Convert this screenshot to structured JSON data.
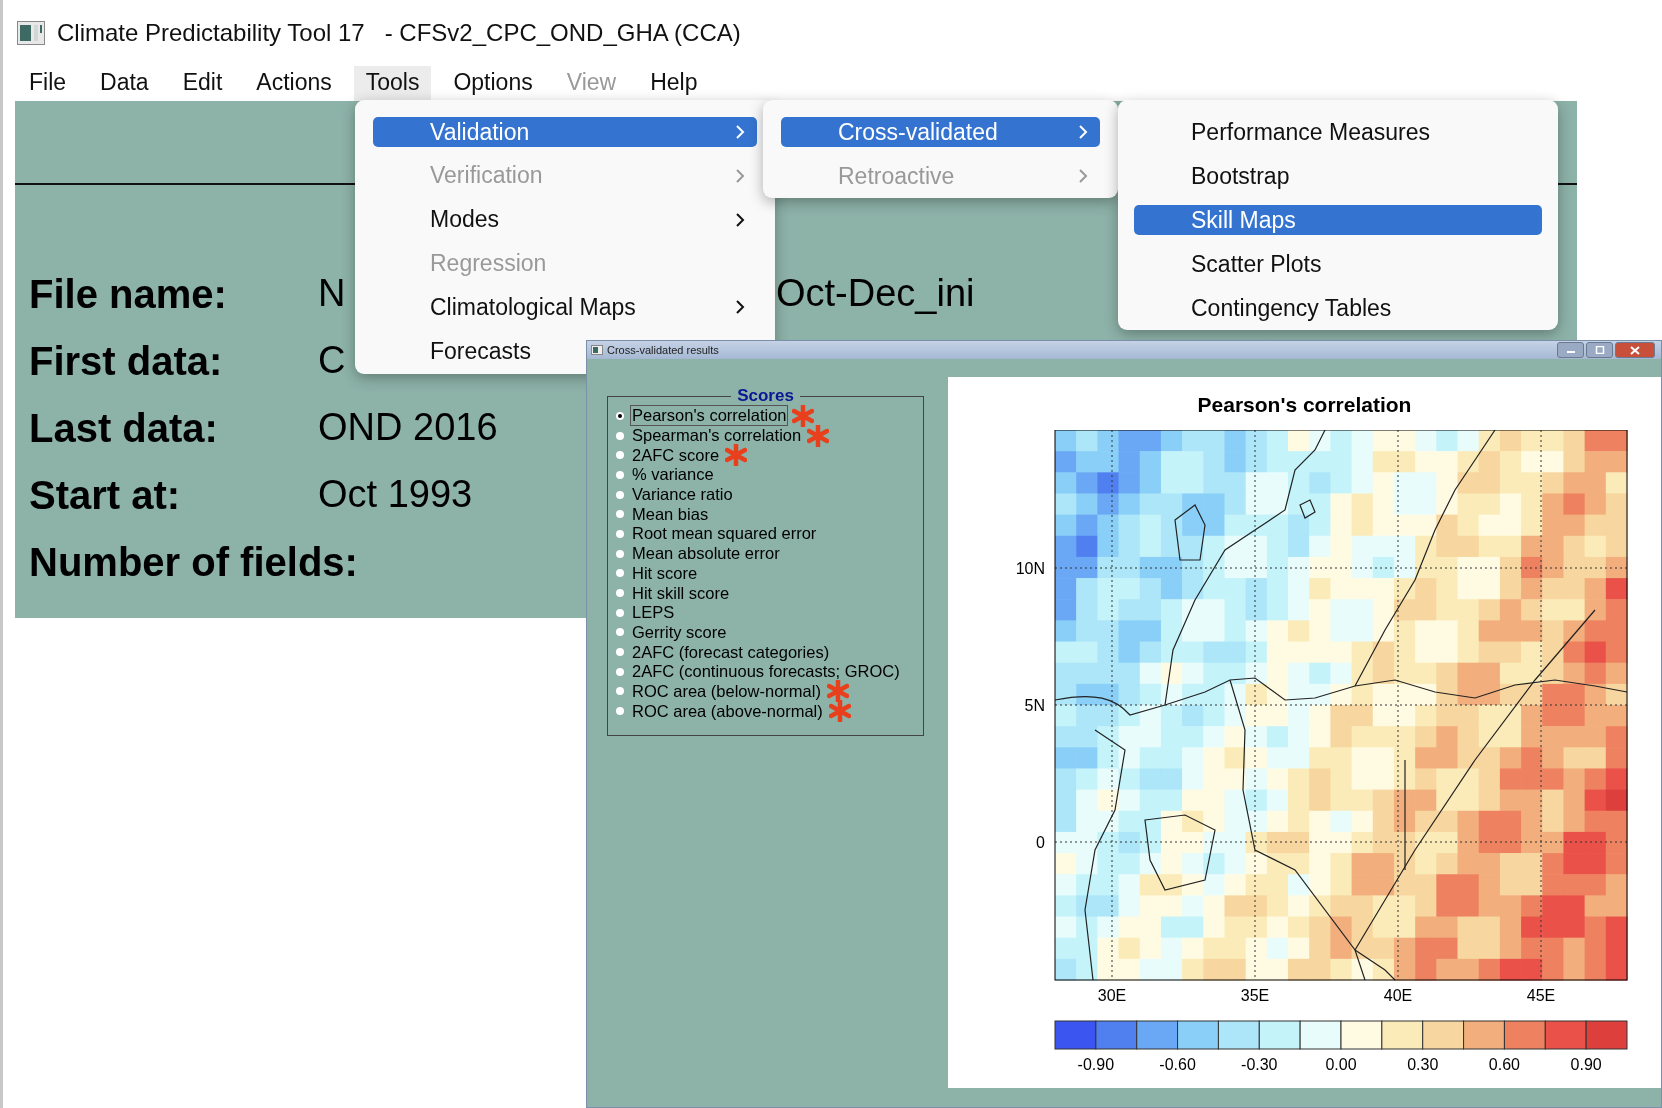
{
  "window": {
    "title": "Climate Predictability Tool 17   - CFSv2_CPC_OND_GHA (CCA)"
  },
  "menu_bar": [
    {
      "label": "File",
      "selected": false,
      "disabled": false
    },
    {
      "label": "Data",
      "selected": false,
      "disabled": false
    },
    {
      "label": "Edit",
      "selected": false,
      "disabled": false
    },
    {
      "label": "Actions",
      "selected": false,
      "disabled": false
    },
    {
      "label": "Tools",
      "selected": true,
      "disabled": false
    },
    {
      "label": "Options",
      "selected": false,
      "disabled": false
    },
    {
      "label": "View",
      "selected": false,
      "disabled": true
    },
    {
      "label": "Help",
      "selected": false,
      "disabled": false
    }
  ],
  "info": [
    {
      "label": "File name:",
      "value": "N",
      "value_2": "Oct-Dec_ini"
    },
    {
      "label": "First data:",
      "value": "C"
    },
    {
      "label": "Last data:",
      "value": "OND 2016"
    },
    {
      "label": "Start at:",
      "value": "Oct 1993"
    },
    {
      "label": "Number of fields:"
    }
  ],
  "tools_menu": [
    {
      "label": "Validation",
      "selected": true,
      "disabled": false,
      "submenu": true
    },
    {
      "label": "Verification",
      "selected": false,
      "disabled": true,
      "submenu": true
    },
    {
      "label": "Modes",
      "selected": false,
      "disabled": false,
      "submenu": true
    },
    {
      "label": "Regression",
      "selected": false,
      "disabled": true,
      "submenu": false
    },
    {
      "label": "Climatological Maps",
      "selected": false,
      "disabled": false,
      "submenu": true
    },
    {
      "label": "Forecasts",
      "selected": false,
      "disabled": false
    }
  ],
  "validation_menu": [
    {
      "label": "Cross-validated",
      "selected": true,
      "disabled": false,
      "submenu": true
    },
    {
      "label": "Retroactive",
      "selected": false,
      "disabled": true,
      "submenu": true
    }
  ],
  "cross_validated_menu": [
    {
      "label": "Performance Measures",
      "selected": false,
      "disabled": false,
      "submenu": false
    },
    {
      "label": "Bootstrap",
      "selected": false,
      "disabled": false,
      "submenu": false
    },
    {
      "label": "Skill Maps",
      "selected": true,
      "disabled": false,
      "submenu": false
    },
    {
      "label": "Scatter Plots",
      "selected": false,
      "disabled": false,
      "submenu": false
    },
    {
      "label": "Contingency Tables",
      "selected": false,
      "disabled": false,
      "submenu": false
    }
  ],
  "results_window": {
    "title": "Cross-validated results",
    "scores": {
      "title": "Scores",
      "items": [
        {
          "label": "Pearson's correlation",
          "selected": true,
          "starred": true
        },
        {
          "label": "Spearman's correlation",
          "selected": false,
          "starred": true
        },
        {
          "label": "2AFC score",
          "selected": false,
          "starred": true
        },
        {
          "label": "% variance",
          "selected": false,
          "starred": false
        },
        {
          "label": "Variance ratio",
          "selected": false,
          "starred": false
        },
        {
          "label": "Mean bias",
          "selected": false,
          "starred": false
        },
        {
          "label": "Root mean squared error",
          "selected": false,
          "starred": false
        },
        {
          "label": "Mean absolute error",
          "selected": false,
          "starred": false
        },
        {
          "label": "Hit score",
          "selected": false,
          "starred": false
        },
        {
          "label": "Hit skill score",
          "selected": false,
          "starred": false
        },
        {
          "label": "LEPS",
          "selected": false,
          "starred": false
        },
        {
          "label": "Gerrity score",
          "selected": false,
          "starred": false
        },
        {
          "label": "2AFC (forecast categories)",
          "selected": false,
          "starred": false
        },
        {
          "label": "2AFC (continuous forecasts; GROC)",
          "selected": false,
          "starred": false
        },
        {
          "label": "ROC area (below-normal)",
          "selected": false,
          "starred": true
        },
        {
          "label": "ROC area (above-normal)",
          "selected": false,
          "starred": true
        }
      ]
    },
    "plot": {
      "title": "Pearson's correlation",
      "y_labels": [
        "10N",
        "5N",
        "0"
      ],
      "x_labels": [
        "30E",
        "35E",
        "40E",
        "45E"
      ],
      "colorbar": {
        "swatches": [
          {
            "color": "#3a55f0"
          },
          {
            "color": "#5080f0"
          },
          {
            "color": "#6aa8f5"
          },
          {
            "color": "#8acff8"
          },
          {
            "color": "#ace6f8"
          },
          {
            "color": "#c5f3fa"
          },
          {
            "color": "#e8fcfc"
          },
          {
            "color": "#fffbe3"
          },
          {
            "color": "#fbebb8"
          },
          {
            "color": "#f7d69f"
          },
          {
            "color": "#f2ae7c"
          },
          {
            "color": "#ee8260"
          },
          {
            "color": "#ea5249"
          },
          {
            "color": "#dd3f3c"
          }
        ],
        "labels": [
          "-0.90",
          "-0.60",
          "-0.30",
          "0.00",
          "0.30",
          "0.60",
          "0.90"
        ]
      }
    }
  }
}
